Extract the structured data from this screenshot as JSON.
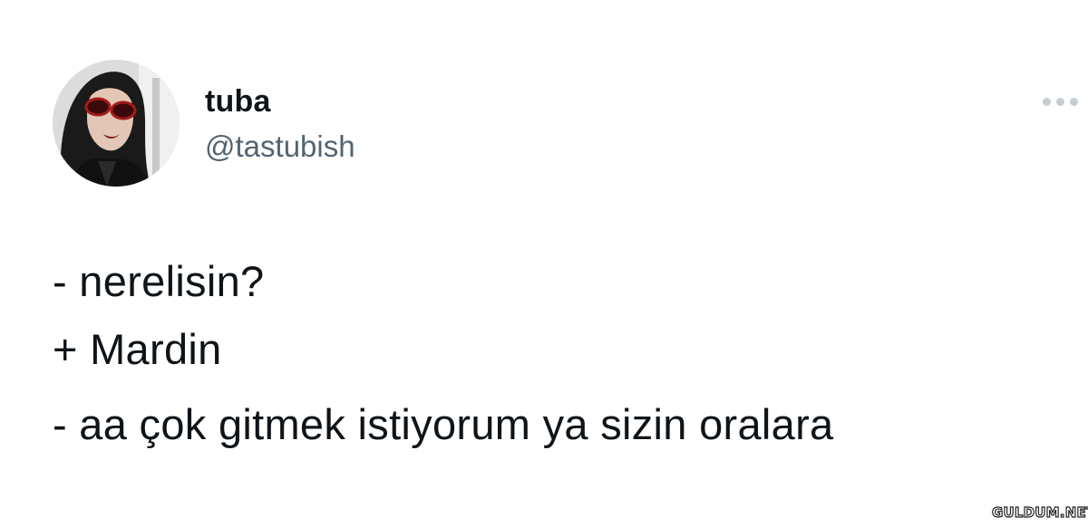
{
  "tweet": {
    "display_name": "tuba",
    "handle": "@tastubish",
    "more_icon": "ellipsis-icon",
    "lines": [
      "- nerelisin?",
      "+ Mardin",
      "- aa çok gitmek istiyorum ya sizin oralara"
    ]
  },
  "watermark": {
    "text": "GULDUM.NET"
  },
  "colors": {
    "text": "#0f1419",
    "secondary_text": "#536471",
    "icon": "#c5cdd3",
    "background": "#ffffff"
  }
}
